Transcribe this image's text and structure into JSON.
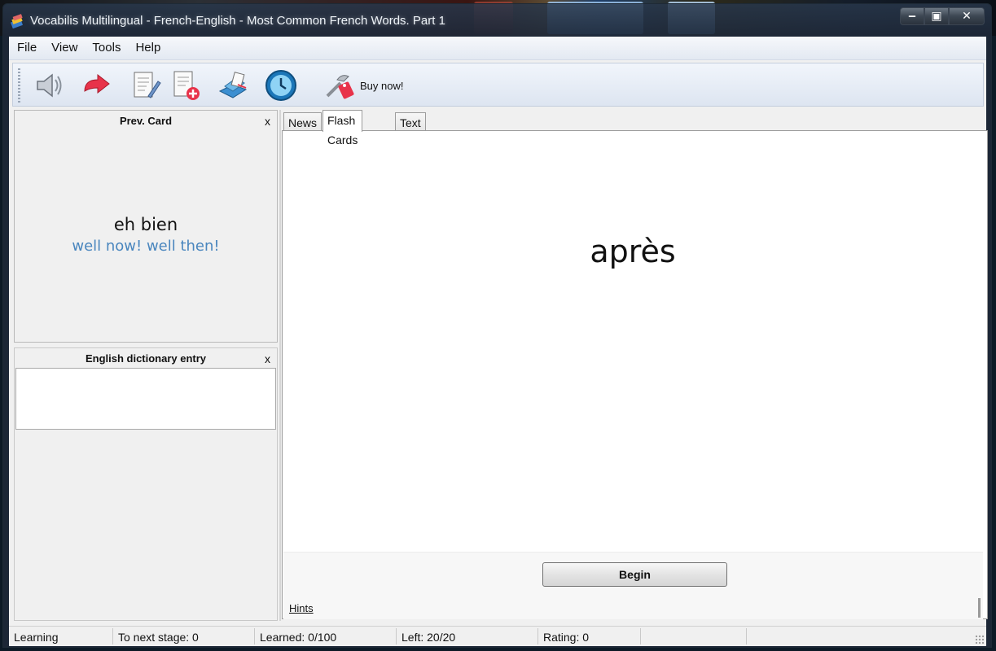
{
  "window": {
    "title": "Vocabilis Multilingual - French-English - Most Common French Words. Part 1",
    "controls": {
      "minimize": "‒",
      "maximize": "▣",
      "close": "✕"
    }
  },
  "menu": [
    "File",
    "View",
    "Tools",
    "Help"
  ],
  "toolbar": {
    "buttons": [
      {
        "icon": "speaker-icon"
      },
      {
        "icon": "arrow-icon"
      },
      {
        "icon": "edit-document-icon"
      },
      {
        "icon": "add-document-icon"
      },
      {
        "icon": "books-icon"
      },
      {
        "icon": "clock-icon"
      }
    ],
    "buy_label": "Buy now!"
  },
  "prev_card": {
    "title": "Prev. Card",
    "close": "x",
    "word": "eh bien",
    "translation": "well now! well then!"
  },
  "dictionary": {
    "title": "English dictionary entry",
    "close": "x"
  },
  "tabs": [
    "News",
    "Flash Cards",
    "Text"
  ],
  "active_tab": "Flash Cards",
  "card": {
    "word": "après",
    "begin_label": "Begin",
    "hints_label": "Hints"
  },
  "status": {
    "mode": "Learning",
    "next_stage": "To next stage: 0",
    "learned": "Learned: 0/100",
    "left": "Left: 20/20",
    "rating": "Rating: 0"
  },
  "colors": {
    "translation": "#4a86be",
    "accent_red": "#e8334a"
  }
}
